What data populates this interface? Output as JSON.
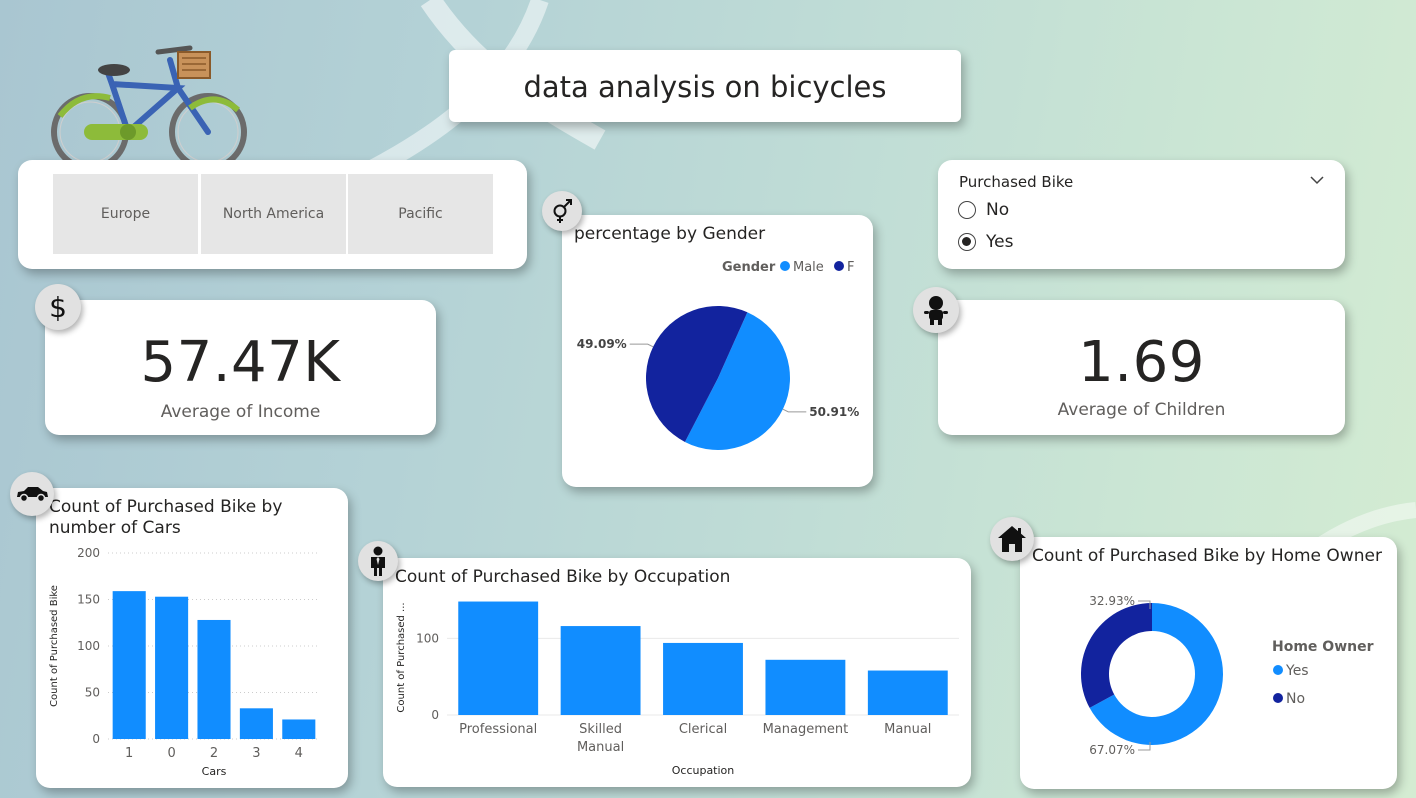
{
  "title": "data analysis on bicycles",
  "colors": {
    "light_blue": "#118dff",
    "dark_blue": "#12239e",
    "badge_gray": "#e1e1e1"
  },
  "region_slicer": {
    "options": [
      "Europe",
      "North America",
      "Pacific"
    ]
  },
  "purchased_filter": {
    "title": "Purchased Bike",
    "options": [
      {
        "label": "No",
        "selected": false
      },
      {
        "label": "Yes",
        "selected": true
      }
    ]
  },
  "kpi_income": {
    "value": "57.47K",
    "label": "Average of Income",
    "icon": "dollar-icon"
  },
  "kpi_children": {
    "value": "1.69",
    "label": "Average of Children",
    "icon": "baby-icon"
  },
  "gender_chart": {
    "title": "percentage by Gender",
    "icon": "gender-icon"
  },
  "cars_chart": {
    "title_line1": "Count of Purchased Bike by",
    "title_line2": "number of Cars",
    "icon": "car-icon"
  },
  "occupation_chart": {
    "title": "Count of Purchased Bike by Occupation",
    "icon": "businessman-icon"
  },
  "homeowner_chart": {
    "title": "Count of Purchased Bike by Home Owner",
    "icon": "house-icon"
  },
  "chart_data": [
    {
      "type": "pie",
      "title": "percentage by Gender",
      "legend_title": "Gender",
      "legend_position": "top-right",
      "slices": [
        {
          "label": "Male",
          "value": 50.91,
          "display": "50.91%",
          "color": "#118dff"
        },
        {
          "label": "F",
          "value": 49.09,
          "display": "49.09%",
          "color": "#12239e"
        }
      ]
    },
    {
      "type": "bar",
      "title": "Count of Purchased Bike by number of Cars",
      "categories": [
        "1",
        "0",
        "2",
        "3",
        "4"
      ],
      "values": [
        159,
        153,
        128,
        33,
        21
      ],
      "xlabel": "Cars",
      "ylabel": "Count of Purchased Bike",
      "ylim": [
        0,
        200
      ],
      "yticks": [
        0,
        50,
        100,
        150,
        200
      ],
      "grid": true,
      "color": "#118dff"
    },
    {
      "type": "bar",
      "title": "Count of Purchased Bike by Occupation",
      "categories": [
        "Professional",
        "Skilled Manual",
        "Clerical",
        "Management",
        "Manual"
      ],
      "values": [
        148,
        116,
        94,
        72,
        58
      ],
      "xlabel": "Occupation",
      "ylabel": "Count of Purchased ...",
      "ylim": [
        0,
        150
      ],
      "yticks": [
        0,
        100
      ],
      "grid": true,
      "color": "#118dff"
    },
    {
      "type": "pie",
      "variant": "donut",
      "title": "Count of Purchased Bike by Home Owner",
      "legend_title": "Home Owner",
      "legend_position": "right",
      "slices": [
        {
          "label": "Yes",
          "value": 67.07,
          "display": "67.07%",
          "color": "#118dff"
        },
        {
          "label": "No",
          "value": 32.93,
          "display": "32.93%",
          "color": "#12239e"
        }
      ]
    }
  ]
}
